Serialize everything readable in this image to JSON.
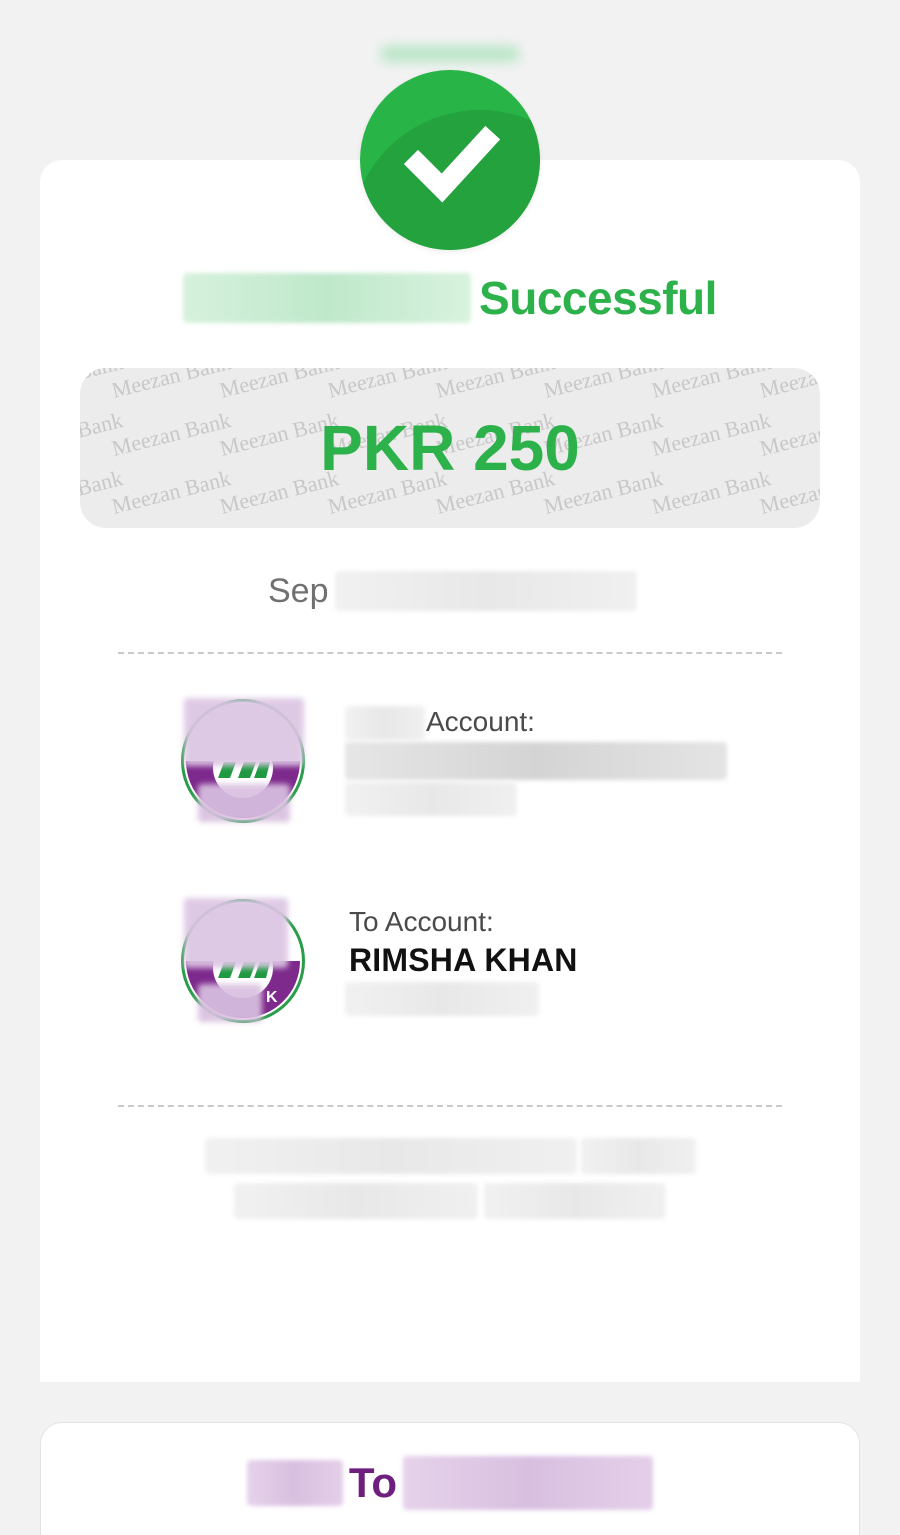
{
  "status": {
    "label": "Successful",
    "color": "#2db24b",
    "icon": "check-icon"
  },
  "amount": {
    "text": "PKR 250",
    "watermark": "Meezan Bank"
  },
  "date": {
    "prefix": "Sep"
  },
  "from_account": {
    "label": "Account:",
    "bank_icon": "meezan-bank-logo"
  },
  "to_account": {
    "label": "To Account:",
    "name": "RIMSHA KHAN",
    "bank_icon": "meezan-bank-logo"
  },
  "footer": {
    "to_word": "To"
  },
  "colors": {
    "success_green": "#2db24b",
    "brand_purple": "#6e1f7e"
  }
}
